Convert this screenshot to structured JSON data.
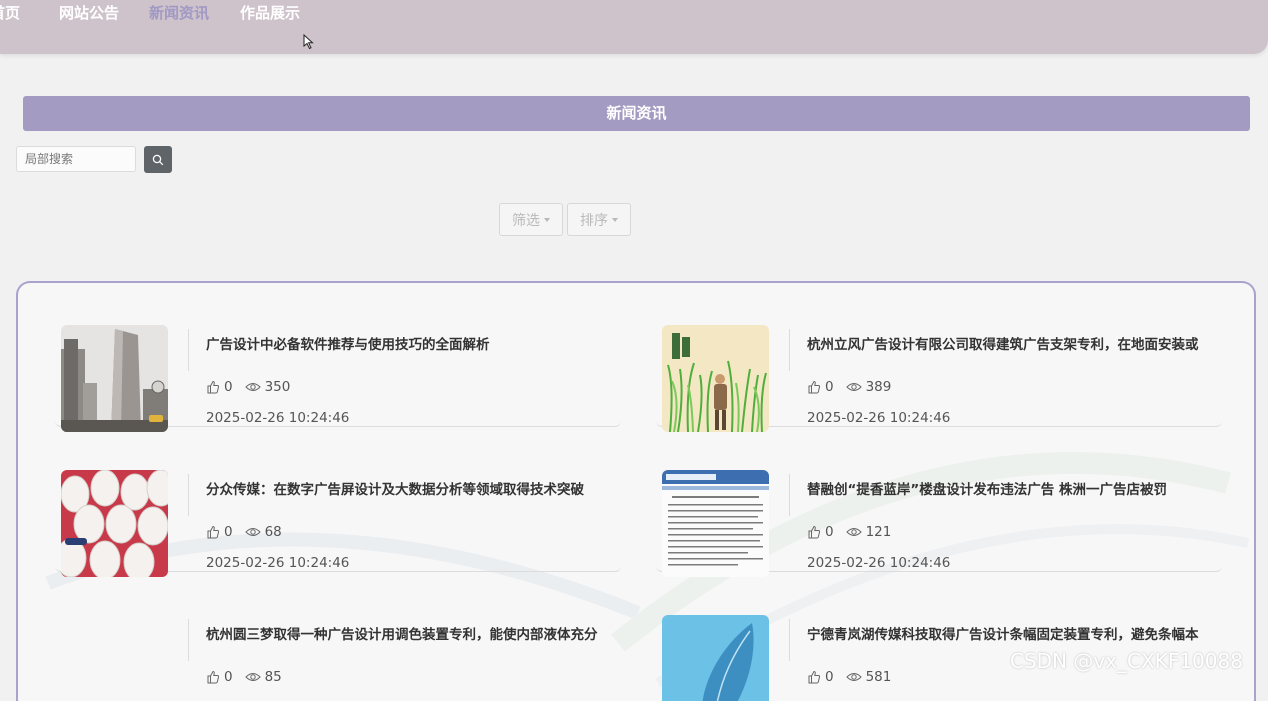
{
  "nav": {
    "items": [
      {
        "label": "首页",
        "active": false
      },
      {
        "label": "网站公告",
        "active": false
      },
      {
        "label": "新闻资讯",
        "active": true
      },
      {
        "label": "作品展示",
        "active": false
      }
    ]
  },
  "section": {
    "title": "新闻资讯"
  },
  "search": {
    "placeholder": "局部搜索"
  },
  "filters": {
    "filter_label": "筛选",
    "sort_label": "排序"
  },
  "news": [
    {
      "title": "广告设计中必备软件推荐与使用技巧的全面解析",
      "likes": "0",
      "views": "350",
      "date": "2025-02-26 10:24:46",
      "thumb": "city-buildings"
    },
    {
      "title": "杭州立风广告设计有限公司取得建筑广告支架专利，在地面安装或",
      "likes": "0",
      "views": "389",
      "date": "2025-02-26 10:24:46",
      "thumb": "grass-illustration"
    },
    {
      "title": "分众传媒：在数字广告屏设计及大数据分析等领域取得技术突破",
      "likes": "0",
      "views": "68",
      "date": "2025-02-26 10:24:46",
      "thumb": "white-buildings"
    },
    {
      "title": "替融创“提香蓝岸”楼盘设计发布违法广告 株洲一广告店被罚",
      "likes": "0",
      "views": "121",
      "date": "2025-02-26 10:24:46",
      "thumb": "document-page"
    },
    {
      "title": "杭州圆三梦取得一种广告设计用调色装置专利，能使内部液体充分",
      "likes": "0",
      "views": "85",
      "date": "",
      "thumb": "none"
    },
    {
      "title": "宁德青岚湖传媒科技取得广告设计条幅固定装置专利，避免条幅本",
      "likes": "0",
      "views": "581",
      "date": "",
      "thumb": "blue-leaf"
    }
  ],
  "watermark": "CSDN @vx_CXKF10088",
  "colors": {
    "nav_bg": "#cfc3cb",
    "nav_active": "#a099c4",
    "section_bar": "#a39bc1",
    "panel_border": "#a8a2cc"
  }
}
